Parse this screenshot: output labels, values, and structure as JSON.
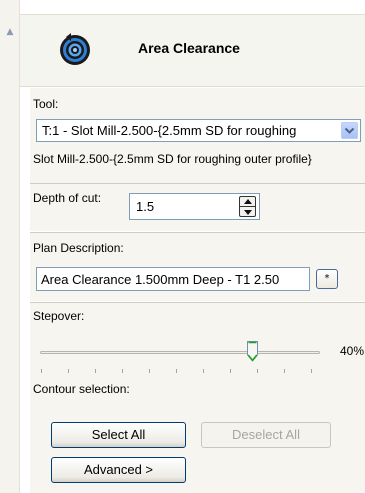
{
  "header": {
    "title": "Area Clearance",
    "icon": "spiral-target-icon"
  },
  "tool": {
    "label": "Tool:",
    "selected": "T:1 - Slot Mill-2.500-{2.5mm SD for roughing",
    "description": "Slot Mill-2.500-{2.5mm SD for roughing outer profile}"
  },
  "depth": {
    "label": "Depth of cut:",
    "value": "1.5"
  },
  "plan": {
    "label": "Plan Description:",
    "value": "Area Clearance 1.500mm Deep - T1 2.50",
    "button_label": "*"
  },
  "stepover": {
    "label": "Stepover:",
    "value_text": "40%",
    "value": 0.4
  },
  "contour": {
    "label": "Contour selection:",
    "select_all": "Select All",
    "deselect_all": "Deselect All",
    "advanced": "Advanced >"
  },
  "colors": {
    "panel": "#f6f5f0",
    "header": "#f5f5f0",
    "border": "#7f9db9",
    "icon_blue": "#1a5fb4"
  }
}
